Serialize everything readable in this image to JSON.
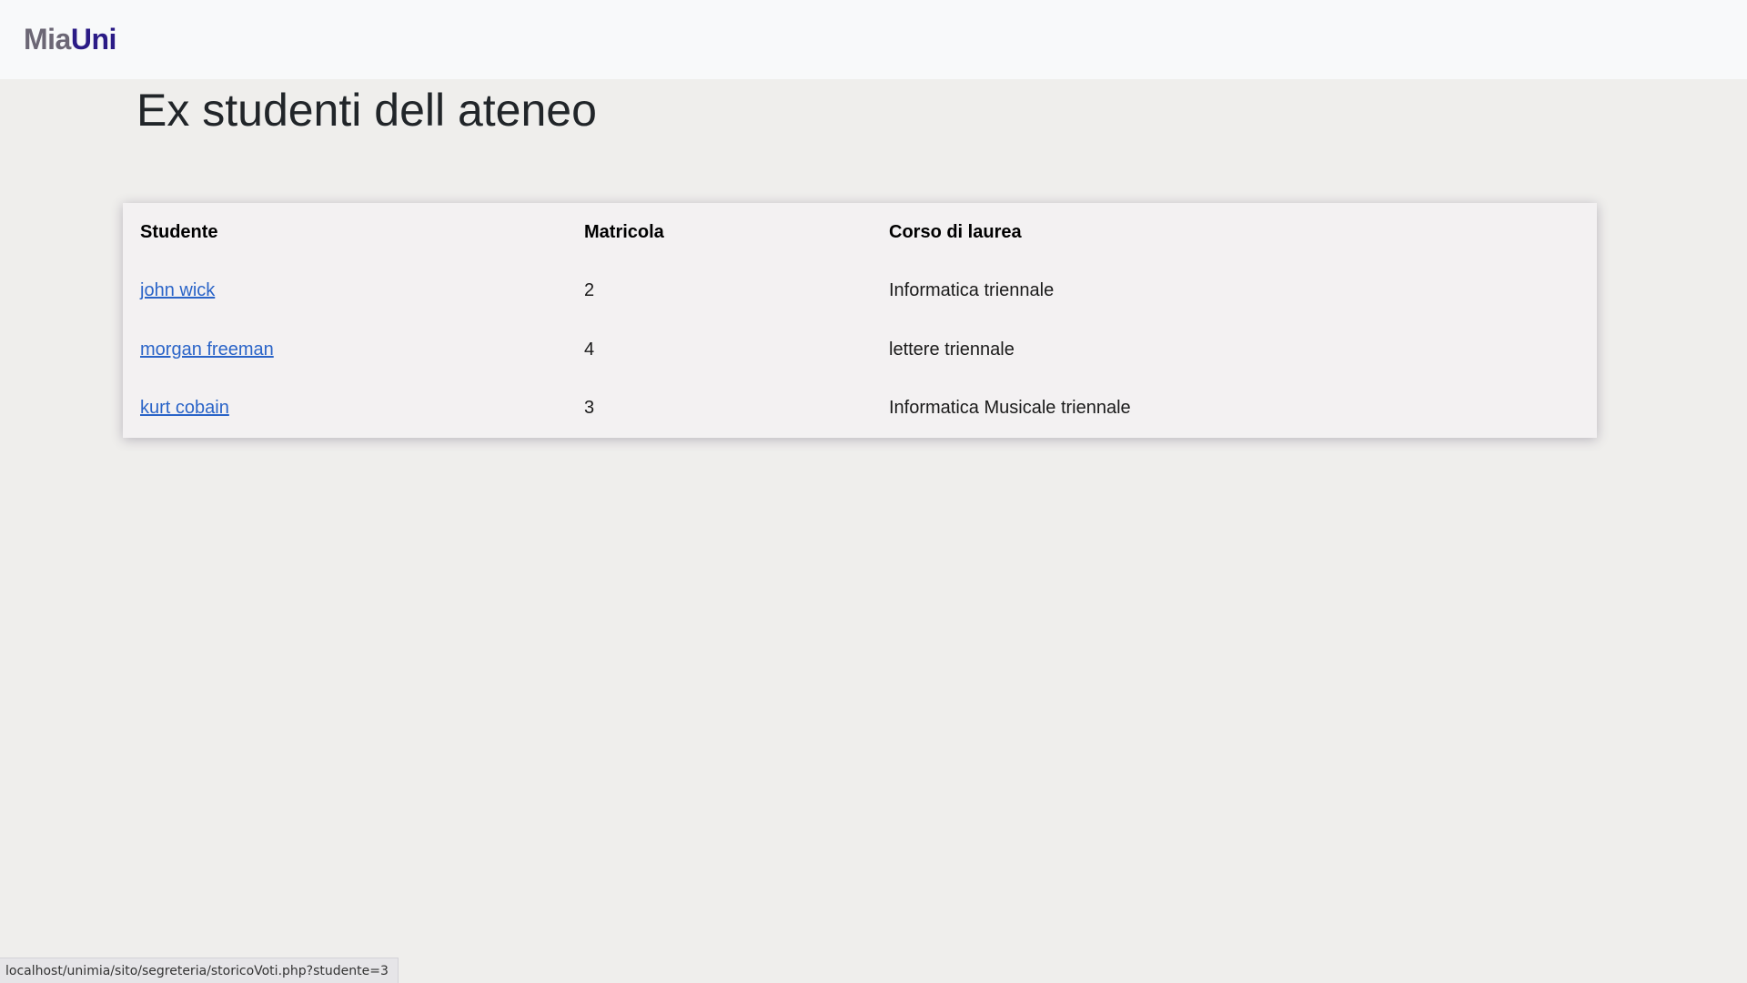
{
  "navbar": {
    "brand_part1": "Mia",
    "brand_part2": "Uni"
  },
  "page_title": "Ex studenti dell ateneo",
  "table": {
    "headers": [
      "Studente",
      "Matricola",
      "Corso di laurea"
    ],
    "rows": [
      {
        "studente": "john wick",
        "matricola": "2",
        "corso": "Informatica triennale"
      },
      {
        "studente": "morgan freeman",
        "matricola": "4",
        "corso": "lettere triennale"
      },
      {
        "studente": "kurt cobain",
        "matricola": "3",
        "corso": "Informatica Musicale triennale"
      }
    ]
  },
  "statusbar": {
    "url": "localhost/unimia/sito/segreteria/storicoVoti.php?studente=3"
  },
  "colors": {
    "brand_mia": "#6c6775",
    "brand_uni": "#2b1b86",
    "link": "#2a64c8",
    "background": "#efeeec",
    "navbar": "#f8f9fa"
  }
}
